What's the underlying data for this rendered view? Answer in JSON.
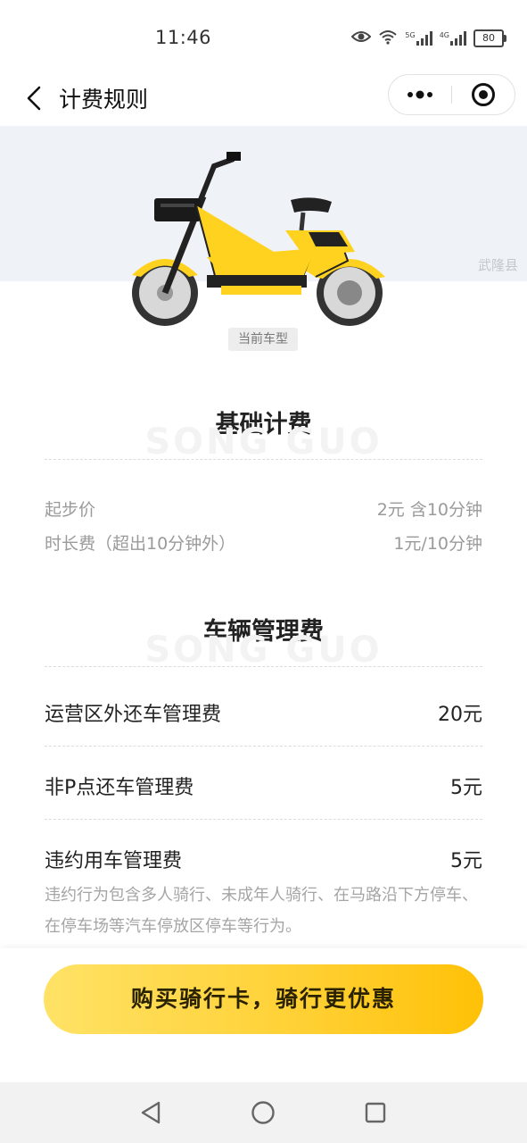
{
  "status_bar": {
    "time": "11:46",
    "battery": "80",
    "network_a": "5G",
    "network_b": "4G"
  },
  "nav": {
    "title": "计费规则"
  },
  "hero": {
    "region": "武隆县",
    "model_tag": "当前车型"
  },
  "watermark": "SONG GUO",
  "basic": {
    "title": "基础计费",
    "rows": [
      {
        "label": "起步价",
        "value": "2元 含10分钟"
      },
      {
        "label": "时长费（超出10分钟外）",
        "value": "1元/10分钟"
      }
    ]
  },
  "management": {
    "title": "车辆管理费",
    "rows": [
      {
        "label": "运营区外还车管理费",
        "value": "20元"
      },
      {
        "label": "非P点还车管理费",
        "value": "5元"
      },
      {
        "label": "违约用车管理费",
        "value": "5元"
      }
    ],
    "description": "违约行为包含多人骑行、未成年人骑行、在马路沿下方停车、在停车场等汽车停放区停车等行为。"
  },
  "cta": {
    "label": "购买骑行卡，骑行更优惠"
  },
  "colors": {
    "accent": "#ffd033",
    "hero_bg": "#eff2f6"
  }
}
